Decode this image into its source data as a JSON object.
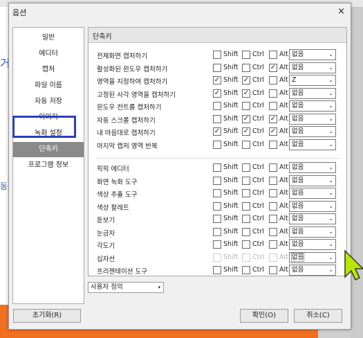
{
  "window": {
    "title": "옵션",
    "close_glyph": "×"
  },
  "background": {
    "chars": [
      "거",
      "동"
    ]
  },
  "nav": {
    "items": [
      {
        "label": "일반",
        "selected": false
      },
      {
        "label": "에디터",
        "selected": false
      },
      {
        "label": "캡처",
        "selected": false
      },
      {
        "label": "파일 이름",
        "selected": false
      },
      {
        "label": "자동 저장",
        "selected": false
      },
      {
        "label": "이미지",
        "selected": false
      },
      {
        "label": "녹화 설정",
        "selected": false
      },
      {
        "label": "단축키",
        "selected": true
      },
      {
        "label": "프로그램 정보",
        "selected": false
      }
    ]
  },
  "panel": {
    "title": "단축키",
    "modifiers": [
      "Shift",
      "Ctrl",
      "Alt"
    ],
    "capture_rows": [
      {
        "label": "전체화면 캡처하기",
        "shift": false,
        "ctrl": false,
        "alt": false,
        "key": "없음"
      },
      {
        "label": "활성화된 윈도우 캡처하기",
        "shift": false,
        "ctrl": false,
        "alt": true,
        "key": "없음"
      },
      {
        "label": "영역을 지정하여 캡처하기",
        "shift": true,
        "ctrl": true,
        "alt": false,
        "key": "Z"
      },
      {
        "label": "고정된 사각 영역을 캡처하기",
        "shift": true,
        "ctrl": true,
        "alt": false,
        "key": "없음"
      },
      {
        "label": "윈도우 컨트롤 캡처하기",
        "shift": false,
        "ctrl": false,
        "alt": false,
        "key": "없음"
      },
      {
        "label": "자동 스크롤 캡처하기",
        "shift": false,
        "ctrl": true,
        "alt": true,
        "key": "없음"
      },
      {
        "label": "내 마음대로 캡처하기",
        "shift": true,
        "ctrl": true,
        "alt": true,
        "key": "없음"
      },
      {
        "label": "마지막 캡처 영역 반복",
        "shift": false,
        "ctrl": false,
        "alt": false,
        "key": "없음"
      }
    ],
    "tool_rows": [
      {
        "label": "픽픽 에디터",
        "shift": false,
        "ctrl": false,
        "alt": false,
        "key": "없음",
        "disabled": false
      },
      {
        "label": "화면 녹화 도구",
        "shift": false,
        "ctrl": false,
        "alt": false,
        "key": "없음",
        "disabled": false
      },
      {
        "label": "색상 추출 도구",
        "shift": false,
        "ctrl": false,
        "alt": false,
        "key": "없음",
        "disabled": false
      },
      {
        "label": "색상 팔레트",
        "shift": false,
        "ctrl": false,
        "alt": false,
        "key": "없음",
        "disabled": false
      },
      {
        "label": "돋보기",
        "shift": false,
        "ctrl": false,
        "alt": false,
        "key": "없음",
        "disabled": false
      },
      {
        "label": "눈금자",
        "shift": false,
        "ctrl": false,
        "alt": false,
        "key": "없음",
        "disabled": false
      },
      {
        "label": "각도기",
        "shift": false,
        "ctrl": false,
        "alt": false,
        "key": "없음",
        "disabled": false
      },
      {
        "label": "십자선",
        "shift": false,
        "ctrl": false,
        "alt": false,
        "key": "없음",
        "disabled": true,
        "focused": true
      },
      {
        "label": "프리젠테이션 도구",
        "shift": false,
        "ctrl": false,
        "alt": false,
        "key": "없음",
        "disabled": false
      }
    ]
  },
  "profile": {
    "value": "사용자 정의"
  },
  "buttons": {
    "reset": "초기화(R)",
    "ok": "확인(O)",
    "cancel": "취소(C)"
  },
  "icons": {
    "check": "✓",
    "dropdown": "⌄",
    "combo": "▾"
  },
  "colors": {
    "selection": "#8a8a8a",
    "highlight_box": "#2b3fbf",
    "cursor": "#b7e600"
  }
}
